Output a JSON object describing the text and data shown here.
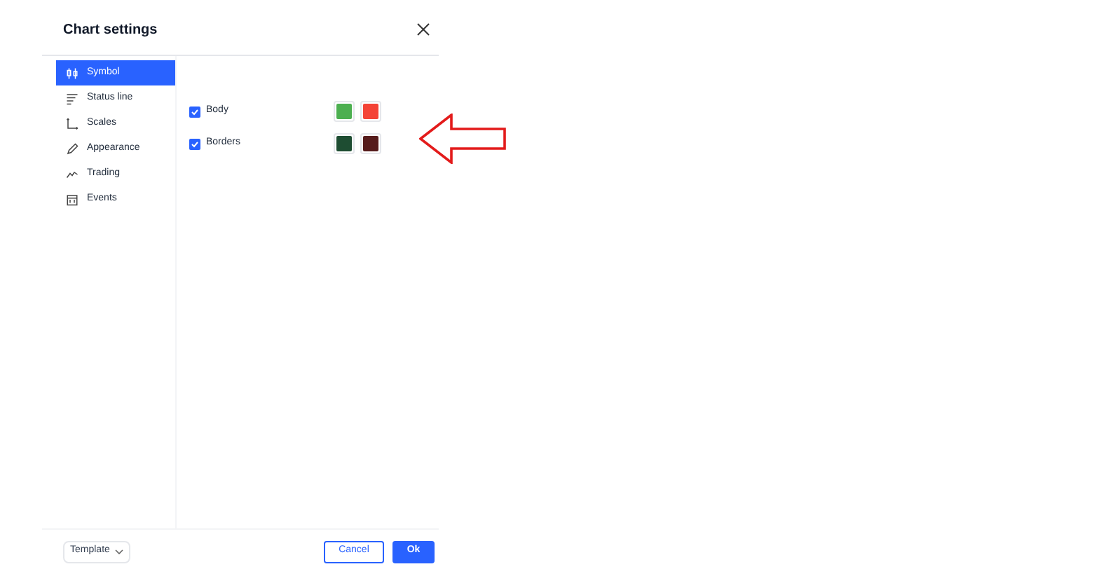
{
  "dialog": {
    "title": "Chart settings"
  },
  "sidebar": {
    "items": [
      {
        "label": "Symbol",
        "selected": true
      },
      {
        "label": "Status line",
        "selected": false
      },
      {
        "label": "Scales",
        "selected": false
      },
      {
        "label": "Appearance",
        "selected": false
      },
      {
        "label": "Trading",
        "selected": false
      },
      {
        "label": "Events",
        "selected": false
      }
    ]
  },
  "rows": [
    {
      "label": "Body",
      "checked": true,
      "swatches": [
        {
          "color": "#4caf50"
        },
        {
          "color": "#f44336"
        }
      ]
    },
    {
      "label": "Borders",
      "checked": true,
      "swatches": [
        {
          "color": "#1e4d32"
        },
        {
          "color": "#561c1c"
        }
      ]
    }
  ],
  "footer": {
    "template": "Template",
    "buttons": [
      {
        "label": "Cancel",
        "kind": "secondary"
      },
      {
        "label": "Ok",
        "kind": "primary"
      }
    ]
  }
}
